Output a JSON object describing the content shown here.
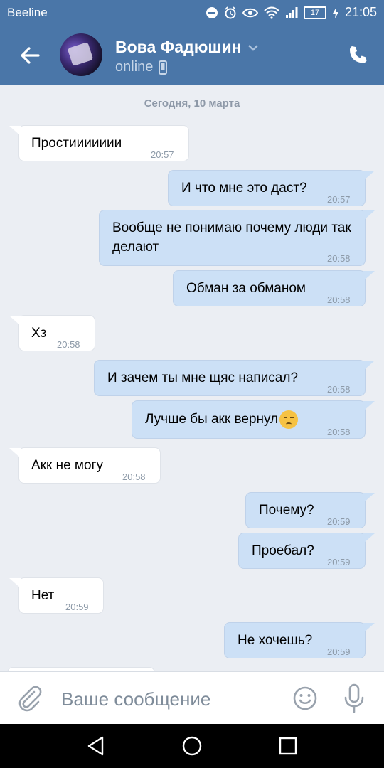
{
  "statusbar": {
    "carrier": "Beeline",
    "battery": "17",
    "time": "21:05",
    "icons": [
      "do-not-disturb-icon",
      "alarm-icon",
      "eye-icon",
      "wifi-icon",
      "signal-icon",
      "battery-icon",
      "charging-icon"
    ]
  },
  "header": {
    "contact_name": "Вова Фадюшин",
    "status": "online",
    "icons": [
      "back-arrow-icon",
      "chevron-down-icon",
      "mobile-icon",
      "phone-icon"
    ]
  },
  "date_divider": "Сегодня, 10 марта",
  "messages": [
    {
      "dir": "in",
      "text": "Простиииииии",
      "time": "20:57"
    },
    {
      "dir": "out",
      "text": "И что мне это даст?",
      "time": "20:57"
    },
    {
      "dir": "out",
      "text": "Вообще не понимаю почему люди так делают",
      "time": "20:58"
    },
    {
      "dir": "out",
      "text": "Обман за обманом",
      "time": "20:58"
    },
    {
      "dir": "in",
      "text": "Хз",
      "time": "20:58"
    },
    {
      "dir": "out",
      "text": "И зачем ты мне щяс написал?",
      "time": "20:58"
    },
    {
      "dir": "out",
      "text": "Лучше бы акк вернул",
      "time": "20:58",
      "emoji": "unamused-face"
    },
    {
      "dir": "in",
      "text": "Акк не могу",
      "time": "20:58"
    },
    {
      "dir": "out",
      "text": "Почему?",
      "time": "20:59"
    },
    {
      "dir": "out",
      "text": "Проебал?",
      "time": "20:59"
    },
    {
      "dir": "in",
      "text": "Нет",
      "time": "20:59"
    },
    {
      "dir": "out",
      "text": "Не хочешь?",
      "time": "20:59"
    }
  ],
  "composer": {
    "placeholder": "Ваше сообщение",
    "icons": [
      "attach-icon",
      "emoji-icon",
      "microphone-icon"
    ]
  },
  "navbar": {
    "icons": [
      "back-nav-icon",
      "home-nav-icon",
      "recents-nav-icon"
    ]
  },
  "colors": {
    "accent": "#4a76a8",
    "background": "#ebeef3",
    "outgoing_bubble": "#cce0f6",
    "incoming_bubble": "#ffffff"
  }
}
